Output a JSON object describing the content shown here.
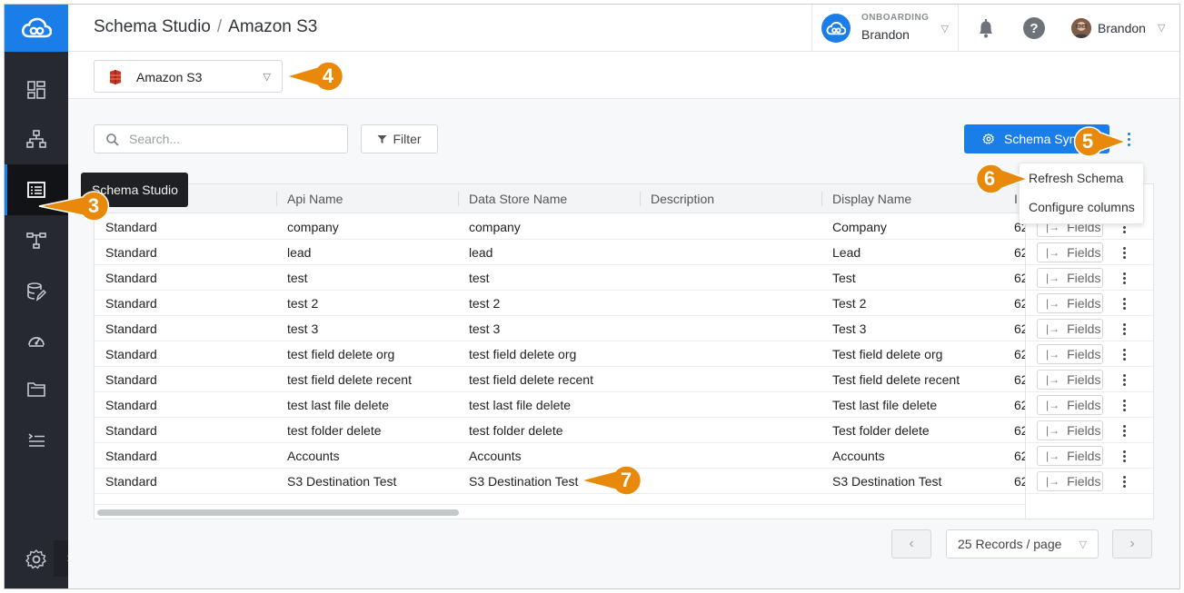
{
  "header": {
    "breadcrumb_root": "Schema Studio",
    "breadcrumb_separator": "/",
    "breadcrumb_current": "Amazon S3",
    "org_label": "ONBOARDING",
    "org_name": "Brandon",
    "user_name": "Brandon"
  },
  "sidebar": {
    "tooltip": "Schema Studio",
    "items": [
      {
        "icon": "dashboard-icon"
      },
      {
        "icon": "hierarchy-icon"
      },
      {
        "icon": "schema-studio-icon",
        "active": true
      },
      {
        "icon": "flow-icon"
      },
      {
        "icon": "data-store-edit-icon"
      },
      {
        "icon": "gauge-icon"
      },
      {
        "icon": "folder-icon"
      },
      {
        "icon": "list-indent-icon"
      }
    ]
  },
  "connection_select": {
    "value": "Amazon S3",
    "icon": "amazon-s3-icon"
  },
  "toolbar": {
    "search_placeholder": "Search...",
    "filter_label": "Filter",
    "sync_label": "Schema Sync"
  },
  "menu": {
    "items": [
      "Refresh Schema",
      "Configure columns"
    ]
  },
  "table": {
    "columns": [
      "Api Name",
      "Data Store Name",
      "Description",
      "Display Name"
    ],
    "fields_label": "Fields",
    "rows": [
      {
        "type": "Standard",
        "api": "company",
        "store": "company",
        "desc": "",
        "display": "Company",
        "trunc": "62"
      },
      {
        "type": "Standard",
        "api": "lead",
        "store": "lead",
        "desc": "",
        "display": "Lead",
        "trunc": "62"
      },
      {
        "type": "Standard",
        "api": "test",
        "store": "test",
        "desc": "",
        "display": "Test",
        "trunc": "62"
      },
      {
        "type": "Standard",
        "api": "test 2",
        "store": "test 2",
        "desc": "",
        "display": "Test 2",
        "trunc": "62"
      },
      {
        "type": "Standard",
        "api": "test 3",
        "store": "test 3",
        "desc": "",
        "display": "Test 3",
        "trunc": "62"
      },
      {
        "type": "Standard",
        "api": "test field delete org",
        "store": "test field delete org",
        "desc": "",
        "display": "Test field delete org",
        "trunc": "62"
      },
      {
        "type": "Standard",
        "api": "test field delete recent",
        "store": "test field delete recent",
        "desc": "",
        "display": "Test field delete recent",
        "trunc": "62"
      },
      {
        "type": "Standard",
        "api": "test last file delete",
        "store": "test last file delete",
        "desc": "",
        "display": "Test last file delete",
        "trunc": "62"
      },
      {
        "type": "Standard",
        "api": "test folder delete",
        "store": "test folder delete",
        "desc": "",
        "display": "Test folder delete",
        "trunc": "62"
      },
      {
        "type": "Standard",
        "api": "Accounts",
        "store": "Accounts",
        "desc": "",
        "display": "Accounts",
        "trunc": "62"
      },
      {
        "type": "Standard",
        "api": "S3 Destination Test",
        "store": "S3 Destination Test",
        "desc": "",
        "display": "S3 Destination Test",
        "trunc": "62"
      }
    ]
  },
  "pagination": {
    "prev": "‹",
    "next": "›",
    "page_size": "25 Records / page"
  },
  "callouts": [
    "3",
    "4",
    "5",
    "6",
    "7"
  ],
  "colors": {
    "accent": "#1a7de8",
    "callout": "#e8890c",
    "sidebar": "#262a30"
  }
}
